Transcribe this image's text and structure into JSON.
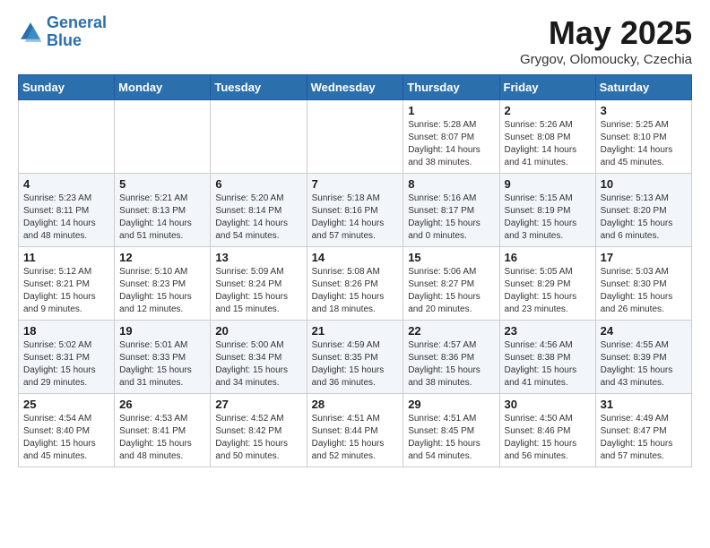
{
  "header": {
    "logo_line1": "General",
    "logo_line2": "Blue",
    "month": "May 2025",
    "location": "Grygov, Olomoucky, Czechia"
  },
  "days_of_week": [
    "Sunday",
    "Monday",
    "Tuesday",
    "Wednesday",
    "Thursday",
    "Friday",
    "Saturday"
  ],
  "weeks": [
    [
      {
        "day": "",
        "info": ""
      },
      {
        "day": "",
        "info": ""
      },
      {
        "day": "",
        "info": ""
      },
      {
        "day": "",
        "info": ""
      },
      {
        "day": "1",
        "info": "Sunrise: 5:28 AM\nSunset: 8:07 PM\nDaylight: 14 hours\nand 38 minutes."
      },
      {
        "day": "2",
        "info": "Sunrise: 5:26 AM\nSunset: 8:08 PM\nDaylight: 14 hours\nand 41 minutes."
      },
      {
        "day": "3",
        "info": "Sunrise: 5:25 AM\nSunset: 8:10 PM\nDaylight: 14 hours\nand 45 minutes."
      }
    ],
    [
      {
        "day": "4",
        "info": "Sunrise: 5:23 AM\nSunset: 8:11 PM\nDaylight: 14 hours\nand 48 minutes."
      },
      {
        "day": "5",
        "info": "Sunrise: 5:21 AM\nSunset: 8:13 PM\nDaylight: 14 hours\nand 51 minutes."
      },
      {
        "day": "6",
        "info": "Sunrise: 5:20 AM\nSunset: 8:14 PM\nDaylight: 14 hours\nand 54 minutes."
      },
      {
        "day": "7",
        "info": "Sunrise: 5:18 AM\nSunset: 8:16 PM\nDaylight: 14 hours\nand 57 minutes."
      },
      {
        "day": "8",
        "info": "Sunrise: 5:16 AM\nSunset: 8:17 PM\nDaylight: 15 hours\nand 0 minutes."
      },
      {
        "day": "9",
        "info": "Sunrise: 5:15 AM\nSunset: 8:19 PM\nDaylight: 15 hours\nand 3 minutes."
      },
      {
        "day": "10",
        "info": "Sunrise: 5:13 AM\nSunset: 8:20 PM\nDaylight: 15 hours\nand 6 minutes."
      }
    ],
    [
      {
        "day": "11",
        "info": "Sunrise: 5:12 AM\nSunset: 8:21 PM\nDaylight: 15 hours\nand 9 minutes."
      },
      {
        "day": "12",
        "info": "Sunrise: 5:10 AM\nSunset: 8:23 PM\nDaylight: 15 hours\nand 12 minutes."
      },
      {
        "day": "13",
        "info": "Sunrise: 5:09 AM\nSunset: 8:24 PM\nDaylight: 15 hours\nand 15 minutes."
      },
      {
        "day": "14",
        "info": "Sunrise: 5:08 AM\nSunset: 8:26 PM\nDaylight: 15 hours\nand 18 minutes."
      },
      {
        "day": "15",
        "info": "Sunrise: 5:06 AM\nSunset: 8:27 PM\nDaylight: 15 hours\nand 20 minutes."
      },
      {
        "day": "16",
        "info": "Sunrise: 5:05 AM\nSunset: 8:29 PM\nDaylight: 15 hours\nand 23 minutes."
      },
      {
        "day": "17",
        "info": "Sunrise: 5:03 AM\nSunset: 8:30 PM\nDaylight: 15 hours\nand 26 minutes."
      }
    ],
    [
      {
        "day": "18",
        "info": "Sunrise: 5:02 AM\nSunset: 8:31 PM\nDaylight: 15 hours\nand 29 minutes."
      },
      {
        "day": "19",
        "info": "Sunrise: 5:01 AM\nSunset: 8:33 PM\nDaylight: 15 hours\nand 31 minutes."
      },
      {
        "day": "20",
        "info": "Sunrise: 5:00 AM\nSunset: 8:34 PM\nDaylight: 15 hours\nand 34 minutes."
      },
      {
        "day": "21",
        "info": "Sunrise: 4:59 AM\nSunset: 8:35 PM\nDaylight: 15 hours\nand 36 minutes."
      },
      {
        "day": "22",
        "info": "Sunrise: 4:57 AM\nSunset: 8:36 PM\nDaylight: 15 hours\nand 38 minutes."
      },
      {
        "day": "23",
        "info": "Sunrise: 4:56 AM\nSunset: 8:38 PM\nDaylight: 15 hours\nand 41 minutes."
      },
      {
        "day": "24",
        "info": "Sunrise: 4:55 AM\nSunset: 8:39 PM\nDaylight: 15 hours\nand 43 minutes."
      }
    ],
    [
      {
        "day": "25",
        "info": "Sunrise: 4:54 AM\nSunset: 8:40 PM\nDaylight: 15 hours\nand 45 minutes."
      },
      {
        "day": "26",
        "info": "Sunrise: 4:53 AM\nSunset: 8:41 PM\nDaylight: 15 hours\nand 48 minutes."
      },
      {
        "day": "27",
        "info": "Sunrise: 4:52 AM\nSunset: 8:42 PM\nDaylight: 15 hours\nand 50 minutes."
      },
      {
        "day": "28",
        "info": "Sunrise: 4:51 AM\nSunset: 8:44 PM\nDaylight: 15 hours\nand 52 minutes."
      },
      {
        "day": "29",
        "info": "Sunrise: 4:51 AM\nSunset: 8:45 PM\nDaylight: 15 hours\nand 54 minutes."
      },
      {
        "day": "30",
        "info": "Sunrise: 4:50 AM\nSunset: 8:46 PM\nDaylight: 15 hours\nand 56 minutes."
      },
      {
        "day": "31",
        "info": "Sunrise: 4:49 AM\nSunset: 8:47 PM\nDaylight: 15 hours\nand 57 minutes."
      }
    ]
  ]
}
